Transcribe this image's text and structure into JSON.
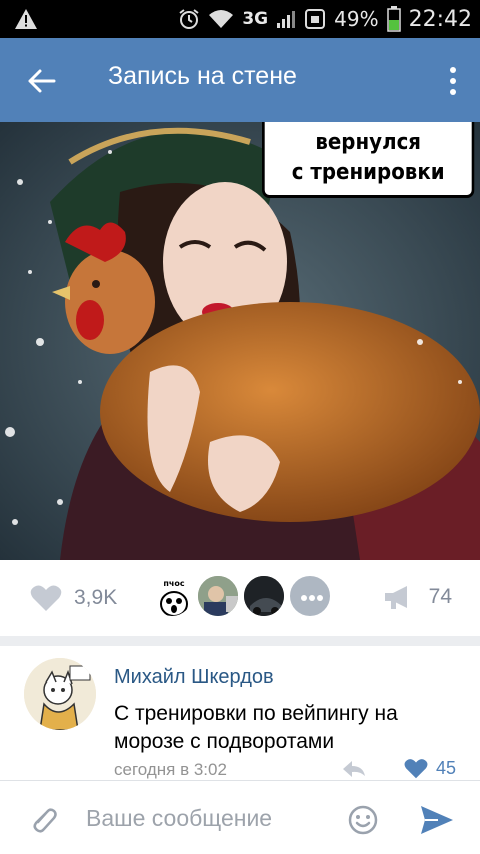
{
  "status_bar": {
    "signal": "3G",
    "battery_percent": "49%",
    "time": "22:42"
  },
  "header": {
    "title": "Запись на стене"
  },
  "post": {
    "image_caption_line1": "вернулся",
    "image_caption_line2": "с тренировки",
    "likes_count": "3,9K",
    "reposts_count": "74",
    "liker_sticker_text": "пчос"
  },
  "comment": {
    "author": "Михайл Шкердов",
    "text": "С тренировки по вейпингу на морозе с подворотами",
    "time": "сегодня в 3:02",
    "likes": "45"
  },
  "composer": {
    "placeholder": "Ваше сообщение"
  },
  "colors": {
    "header_bg": "#5181b8",
    "link": "#2a5885",
    "icon_gray": "#828a99",
    "accent": "#5181b8"
  }
}
